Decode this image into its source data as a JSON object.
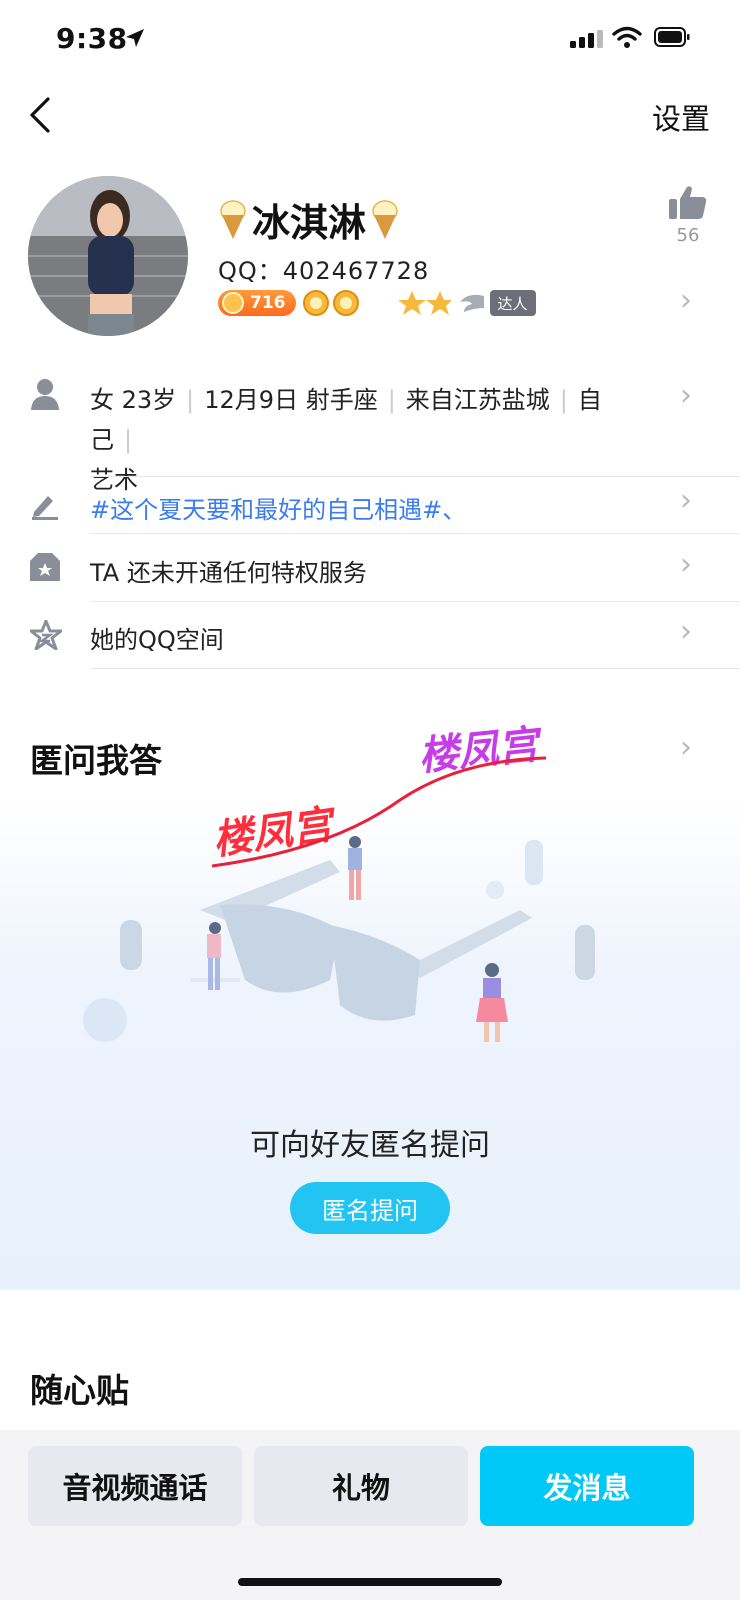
{
  "status_bar": {
    "time": "9:38"
  },
  "header": {
    "settings_label": "设置"
  },
  "profile": {
    "name": "冰淇淋",
    "qq_label": "QQ：",
    "qq_number": "402467728",
    "coin_count": "716",
    "daren_label": "达人",
    "likes": "56"
  },
  "info": {
    "gender_age": "女 23岁",
    "birthday": "12月9日 射手座",
    "location": "来自江苏盐城",
    "job": "自己",
    "job_cont": "艺术",
    "signature": "#这个夏天要和最好的自己相遇#、",
    "privilege": "TA 还未开通任何特权服务",
    "space": "她的QQ空间"
  },
  "qa": {
    "title": "匿问我答",
    "caption": "可向好友匿名提问",
    "button": "匿名提问",
    "watermark": "楼凤宫"
  },
  "sticky": {
    "title": "随心贴"
  },
  "bottom_bar": {
    "call": "音视频通话",
    "gift": "礼物",
    "message": "发消息"
  },
  "colors": {
    "accent": "#00c8f7",
    "link": "#3b7cf0"
  }
}
